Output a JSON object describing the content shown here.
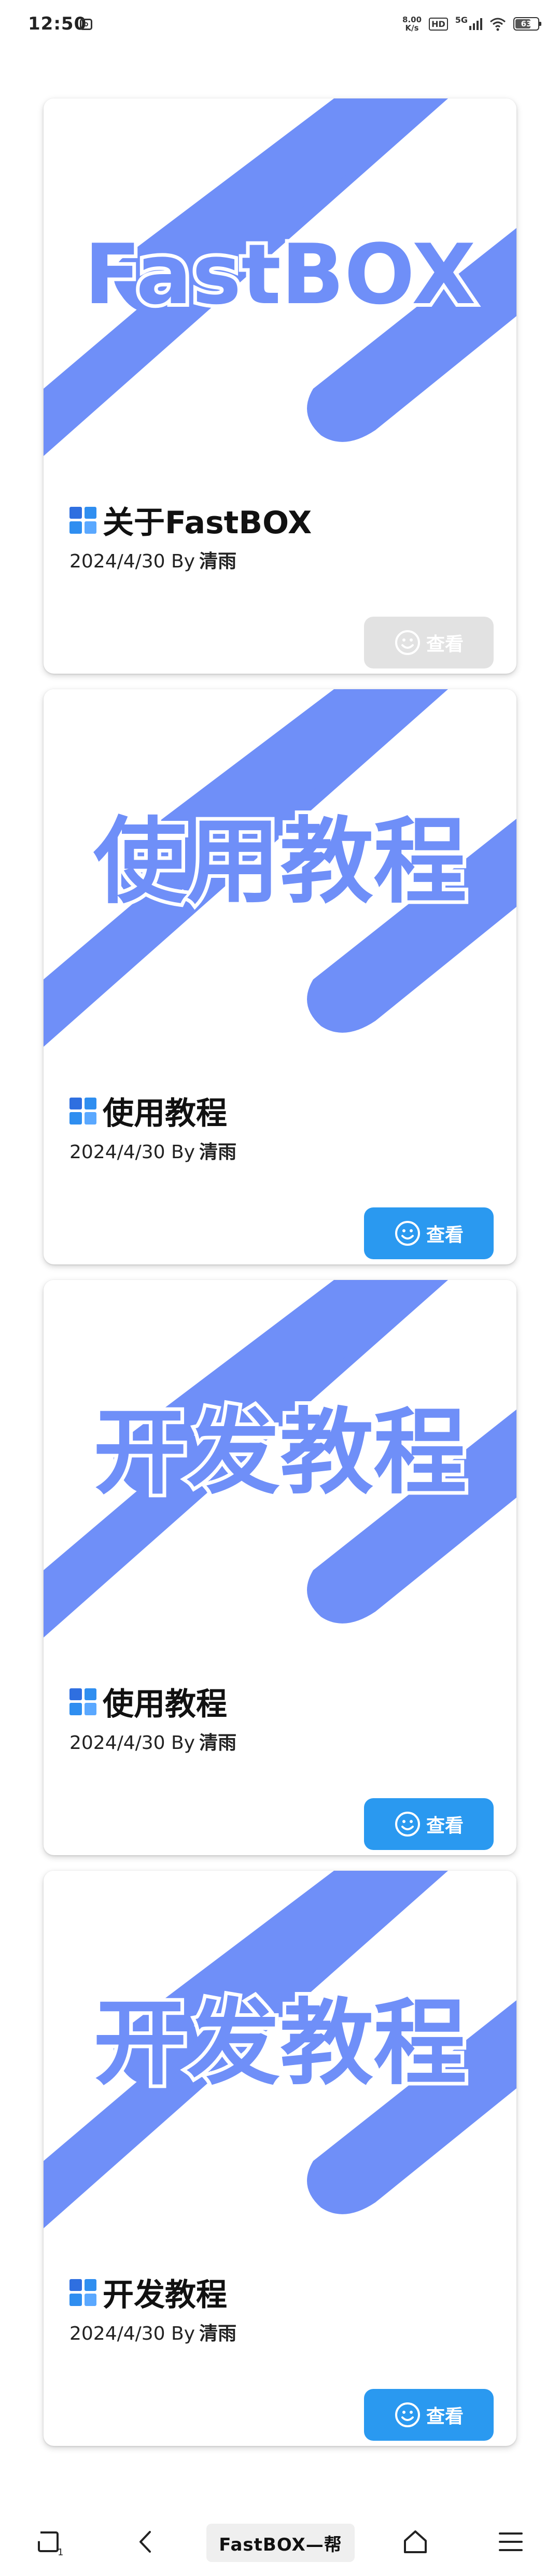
{
  "status_bar": {
    "time": "12:50",
    "net_speed_value": "8.00",
    "net_speed_unit": "K/s",
    "hd_label": "HD",
    "network_label": "5G",
    "battery_level": "63"
  },
  "colors": {
    "cover_blue": "#6f8ff8",
    "button_blue": "#2a99f0",
    "button_disabled": "#e2e2e2"
  },
  "posts": [
    {
      "cover_text": "FastBOX",
      "title": "关于FastBOX",
      "date": "2024/4/30",
      "by_label": "By",
      "author": "清雨",
      "button_label": "查看",
      "button_disabled": true
    },
    {
      "cover_text": "使用教程",
      "title": "使用教程",
      "date": "2024/4/30",
      "by_label": "By",
      "author": "清雨",
      "button_label": "查看",
      "button_disabled": false
    },
    {
      "cover_text": "开发教程",
      "title": "使用教程",
      "date": "2024/4/30",
      "by_label": "By",
      "author": "清雨",
      "button_label": "查看",
      "button_disabled": false
    },
    {
      "cover_text": "开发教程",
      "title": "开发教程",
      "date": "2024/4/30",
      "by_label": "By",
      "author": "清雨",
      "button_label": "查看",
      "button_disabled": false
    }
  ],
  "bottom_nav": {
    "tab_title": "FastBOX—帮",
    "tab_count": "1",
    "icons": [
      "tabs-icon",
      "back-icon",
      "home-icon",
      "menu-icon"
    ]
  }
}
